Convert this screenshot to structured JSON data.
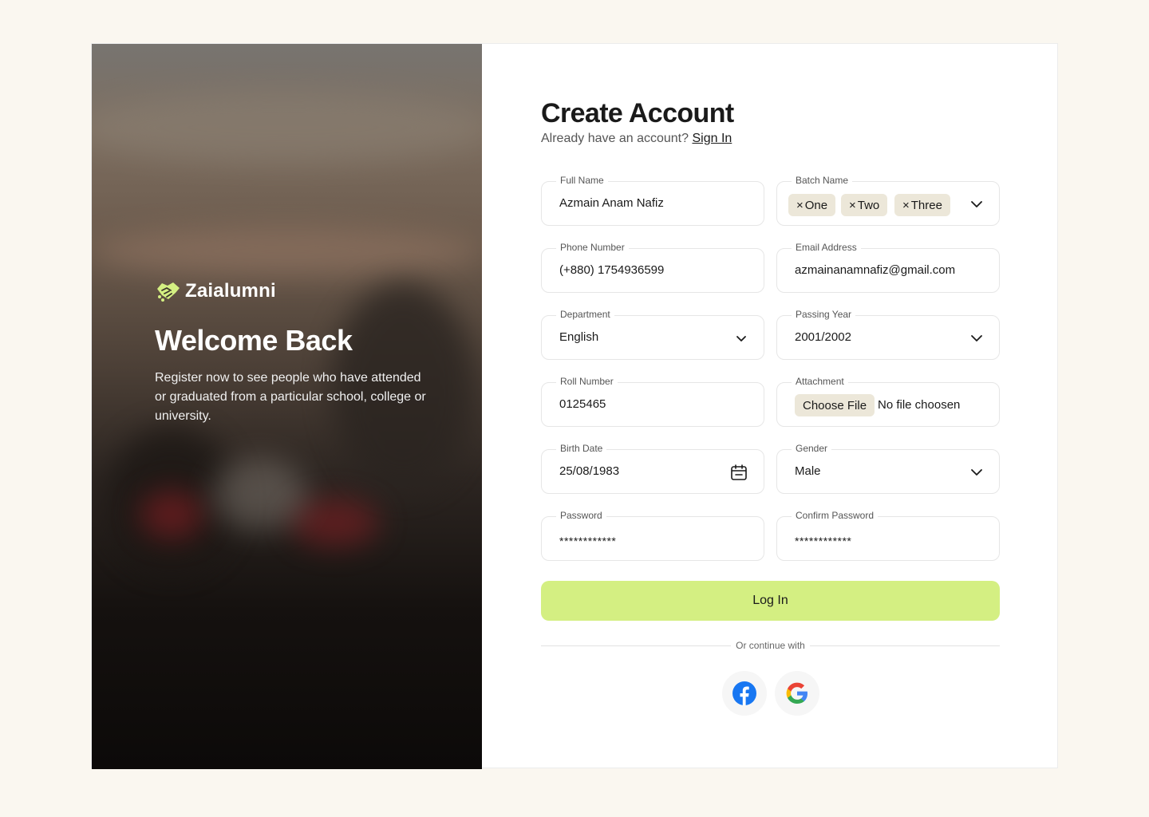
{
  "brand": {
    "name": "Zaialumni",
    "accent": "#d4ef82"
  },
  "hero": {
    "title": "Welcome Back",
    "description": "Register now to see people who have attended or graduated from a particular school, college or university."
  },
  "form": {
    "title": "Create Account",
    "signin_prompt": "Already have an account?",
    "signin_link": "Sign In",
    "full_name": {
      "label": "Full Name",
      "value": "Azmain Anam Nafiz"
    },
    "batch_name": {
      "label": "Batch Name",
      "chips": [
        "One",
        "Two",
        "Three"
      ]
    },
    "phone": {
      "label": "Phone Number",
      "value": "(+880) 1754936599"
    },
    "email": {
      "label": "Email Address",
      "value": "azmainanamnafiz@gmail.com"
    },
    "department": {
      "label": "Department",
      "value": "English"
    },
    "passing_year": {
      "label": "Passing Year",
      "value": "2001/2002"
    },
    "roll": {
      "label": "Roll Number",
      "value": "0125465"
    },
    "attachment": {
      "label": "Attachment",
      "button": "Choose File",
      "status": "No file choosen"
    },
    "birth_date": {
      "label": "Birth Date",
      "value": "25/08/1983"
    },
    "gender": {
      "label": "Gender",
      "value": "Male"
    },
    "password": {
      "label": "Password",
      "value": "************"
    },
    "confirm_password": {
      "label": "Confirm Password",
      "value": "************"
    },
    "submit": "Log In",
    "divider_text": "Or continue with",
    "social": [
      "facebook-icon",
      "google-icon"
    ]
  },
  "colors": {
    "background": "#faf7f0",
    "chip": "#ece7d9",
    "facebook": "#1877f2"
  }
}
